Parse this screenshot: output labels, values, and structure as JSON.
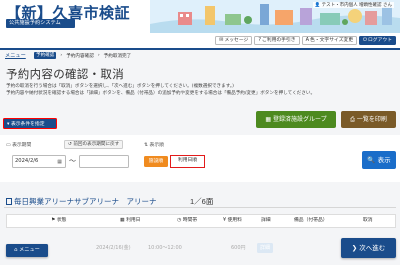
{
  "header": {
    "city_title": "【新】久喜市検証",
    "system_name": "公共施設予約システム",
    "user_text": "テスト・市内個人 増顕性確認 さん",
    "buttons": [
      {
        "icon": "✉",
        "label": "メッセージ"
      },
      {
        "icon": "?",
        "label": "ご利用の手引き"
      },
      {
        "icon": "A",
        "label": "色・文字サイズ変更"
      },
      {
        "icon": "⏻",
        "label": "ログアウト"
      }
    ]
  },
  "breadcrumb": {
    "menu_link": "メニュー",
    "items": [
      "予約確認",
      "予約内容確認",
      "予約取消完了"
    ]
  },
  "page": {
    "title": "予約内容の確認・取消",
    "desc1": "予約の取消を行う場合は「取消」ボタンを選択し、「次へ進む」ボタンを押してください。(複数選択できます。)",
    "desc2": "予約内容や納付状況を確認する場合は「詳細」ボタンを、備品（付帯品）の追加予約や変更をする場合は「備品予約/変更」ボタンを押してください。"
  },
  "actions": {
    "show_conditions": "表示条件を指定",
    "register_group": "登録済施設グループ",
    "print_list": "一覧を印刷"
  },
  "filter": {
    "period_label": "表示期間",
    "prev_period_label": "前回の表示期間に戻す",
    "order_label": "表示順",
    "date_from": "2024/2/6",
    "date_to": "",
    "order_facility": "施設順",
    "order_date": "利用日順",
    "show_button": "表示"
  },
  "facility": {
    "name": "毎日興業アリーナサブアリーナ　アリーナ",
    "count": "1／6面"
  },
  "table": {
    "headers": [
      "状態",
      "利用日",
      "時間帯",
      "使用料",
      "詳細",
      "備品（付帯品）",
      "取消"
    ],
    "rows": [
      {
        "status": "",
        "date": "2024/2/16(金)",
        "time": "10:00～12:00",
        "fee": "600円",
        "detail": "詳細",
        "equipment": "",
        "cancel": ""
      }
    ]
  },
  "footer": {
    "menu_button": "メニュー",
    "next_button": "次へ進む"
  }
}
